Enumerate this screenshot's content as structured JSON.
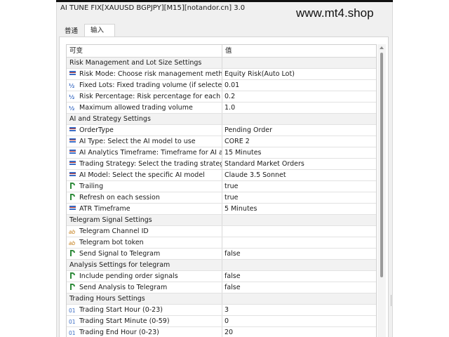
{
  "window": {
    "title": "AI TUNE FIX[XAUUSD BGPJPY][M15][notandor.cn] 3.0",
    "watermark": "www.mt4.shop"
  },
  "tabs": [
    {
      "label": "普通"
    },
    {
      "label": "输入"
    }
  ],
  "table": {
    "headers": {
      "variable": "可变",
      "value": "值"
    },
    "rows": [
      {
        "type": "section",
        "name": "Risk Management and Lot Size Settings",
        "value": ""
      },
      {
        "type": "enum",
        "name": "Risk Mode: Choose risk management meth...",
        "value": "Equity Risk(Auto Lot)"
      },
      {
        "type": "double",
        "name": "Fixed Lots: Fixed trading volume (if selected)",
        "value": "0.01"
      },
      {
        "type": "double",
        "name": "Risk Percentage: Risk percentage for each t...",
        "value": "0.2"
      },
      {
        "type": "double",
        "name": "Maximum allowed trading volume",
        "value": "1.0"
      },
      {
        "type": "section",
        "name": "AI and Strategy Settings",
        "value": ""
      },
      {
        "type": "enum",
        "name": "OrderType",
        "value": "Pending Order"
      },
      {
        "type": "enum",
        "name": "AI Type: Select the AI model to use",
        "value": "CORE 2"
      },
      {
        "type": "enum",
        "name": "AI Analytics Timeframe: Timeframe for AI an...",
        "value": "15 Minutes"
      },
      {
        "type": "enum",
        "name": "Trading Strategy: Select the trading strategy...",
        "value": "Standard Market Orders"
      },
      {
        "type": "enum",
        "name": "AI Model: Select the specific AI model",
        "value": "Claude 3.5 Sonnet"
      },
      {
        "type": "bool",
        "name": "Trailing",
        "value": "true"
      },
      {
        "type": "bool",
        "name": "Refresh on each session",
        "value": "true"
      },
      {
        "type": "enum",
        "name": "ATR Timeframe",
        "value": "5 Minutes"
      },
      {
        "type": "section",
        "name": "Telegram Signal Settings",
        "value": ""
      },
      {
        "type": "string",
        "name": "Telegram Channel ID",
        "value": ""
      },
      {
        "type": "string",
        "name": "Telegram bot token",
        "value": ""
      },
      {
        "type": "bool",
        "name": "Send Signal to Telegram",
        "value": "false"
      },
      {
        "type": "section",
        "name": "Analysis Settings for telegram",
        "value": ""
      },
      {
        "type": "bool",
        "name": "Include pending order signals",
        "value": "false"
      },
      {
        "type": "bool",
        "name": "Send Analysis to Telegram",
        "value": "false"
      },
      {
        "type": "section",
        "name": "Trading Hours Settings",
        "value": ""
      },
      {
        "type": "int",
        "name": "Trading Start Hour (0-23)",
        "value": "3"
      },
      {
        "type": "int",
        "name": "Trading Start Minute (0-59)",
        "value": "0"
      },
      {
        "type": "int",
        "name": "Trading End Hour (0-23)",
        "value": "20"
      }
    ]
  },
  "icons": {
    "enum": "enum-list-icon",
    "double": "fraction-icon",
    "bool": "boolean-arrow-icon",
    "string": "string-ab-icon",
    "int": "integer-01-icon"
  },
  "colors": {
    "section_bg": "#f2f2f2",
    "enum_icon": "#3b6cc4",
    "bool_icon": "#2e8b3a",
    "string_icon": "#c47d18"
  }
}
